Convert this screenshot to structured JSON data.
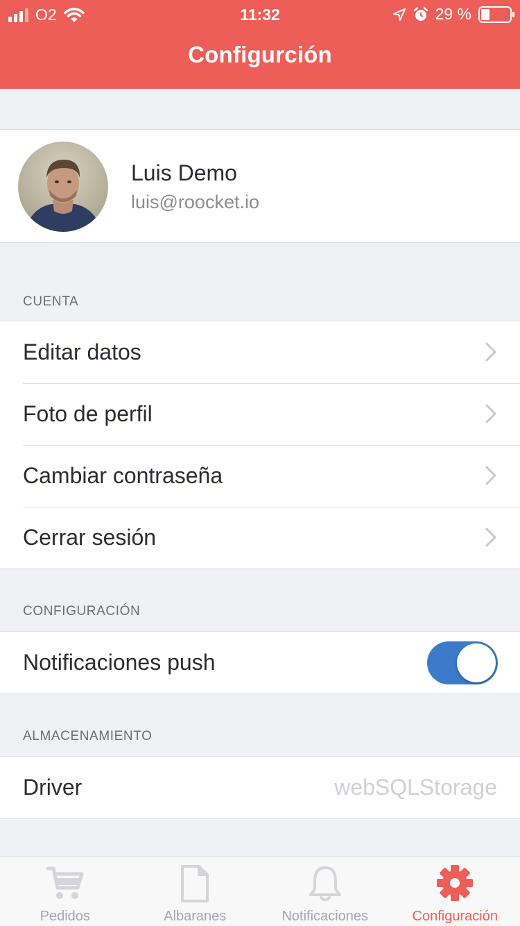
{
  "status_bar": {
    "carrier": "O2",
    "time": "11:32",
    "battery_percent": "29 %",
    "battery_level": 0.29
  },
  "nav": {
    "title": "Configurción"
  },
  "profile": {
    "name": "Luis Demo",
    "email": "luis@roocket.io"
  },
  "sections": {
    "account": {
      "label": "CUENTA",
      "items": [
        {
          "label": "Editar datos"
        },
        {
          "label": "Foto de perfil"
        },
        {
          "label": "Cambiar contraseña"
        },
        {
          "label": "Cerrar sesión"
        }
      ]
    },
    "settings": {
      "label": "CONFIGURACIÓN",
      "push_label": "Notificaciones push",
      "push_enabled": true
    },
    "storage": {
      "label": "ALMACENAMIENTO",
      "driver_label": "Driver",
      "driver_value": "webSQLStorage"
    }
  },
  "tabs": [
    {
      "label": "Pedidos",
      "icon": "cart-icon"
    },
    {
      "label": "Albaranes",
      "icon": "document-icon"
    },
    {
      "label": "Notificaciones",
      "icon": "bell-icon"
    },
    {
      "label": "Configuración",
      "icon": "gear-icon",
      "active": true
    }
  ],
  "colors": {
    "accent": "#ec5e57",
    "toggle_on": "#3b7bca",
    "background": "#eff1f4"
  }
}
